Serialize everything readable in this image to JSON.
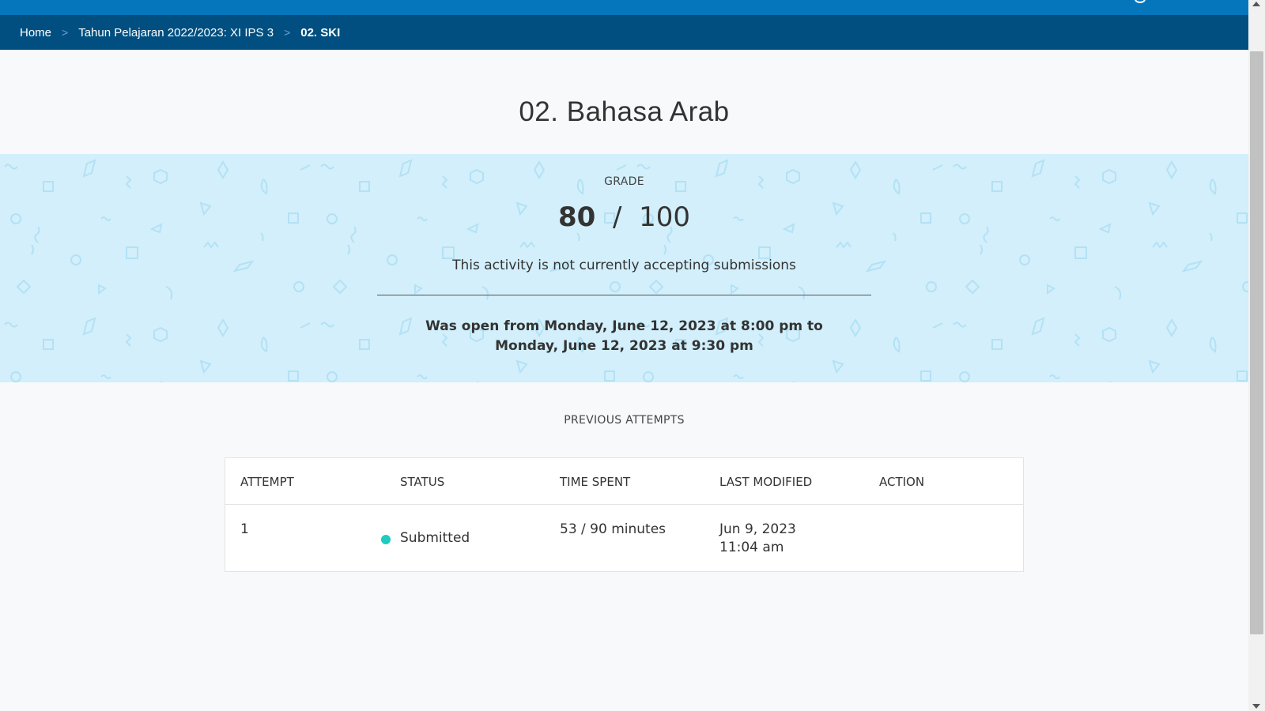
{
  "breadcrumb": {
    "home": "Home",
    "course": "Tahun Pelajaran 2022/2023: XI IPS 3",
    "current": "02. SKI",
    "separator": ">"
  },
  "page": {
    "title": "02. Bahasa Arab"
  },
  "grade": {
    "label": "GRADE",
    "score": "80",
    "slash": "/",
    "max": "100",
    "notice": "This activity is not currently accepting submissions",
    "open_dates": "Was open from Monday, June 12, 2023 at 8:00 pm to Monday, June 12, 2023 at 9:30 pm"
  },
  "attempts": {
    "section_label": "PREVIOUS ATTEMPTS",
    "columns": [
      "ATTEMPT",
      "STATUS",
      "TIME SPENT",
      "LAST MODIFIED",
      "ACTION"
    ],
    "rows": [
      {
        "attempt": "1",
        "status": "Submitted",
        "time_spent": "53 / 90 minutes",
        "last_modified_date": "Jun 9, 2023",
        "last_modified_time": "11:04 am",
        "action": ""
      }
    ]
  },
  "colors": {
    "topbar": "#0576bc",
    "breadcrumb_bar": "#004f80",
    "grade_panel": "#d2effb",
    "status_submitted": "#1ecbc0"
  },
  "icons": [
    "user-avatar-icon",
    "status-dot-icon",
    "scroll-up-icon",
    "scroll-down-icon"
  ]
}
